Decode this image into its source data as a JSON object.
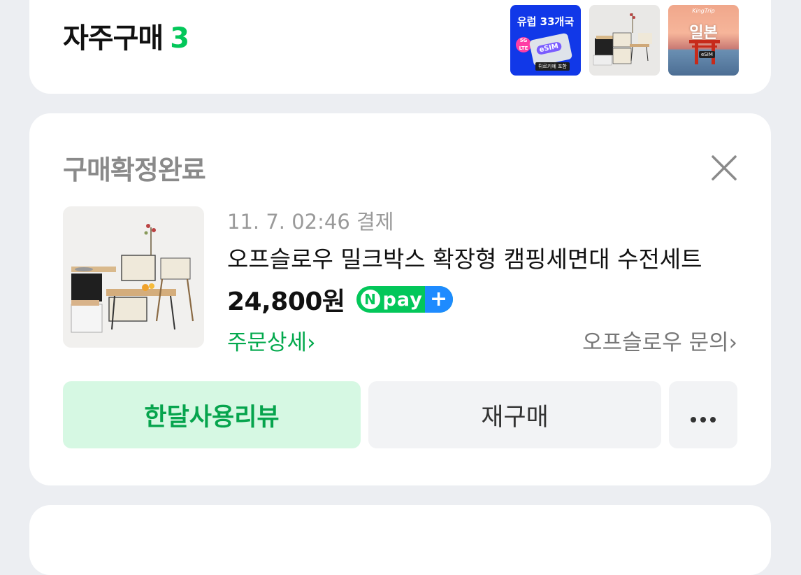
{
  "frequent": {
    "title": "자주구매",
    "count": "3",
    "thumbs": [
      {
        "name": "esim-europe",
        "headline": "유럽 33개국",
        "badge": "5G LTE",
        "sim": "eSIM",
        "sub": "튀르키예 포함"
      },
      {
        "name": "camping-washstand"
      },
      {
        "name": "esim-japan",
        "script": "KingTrip",
        "headline": "일본",
        "tag": "eSIM"
      }
    ]
  },
  "order": {
    "status": "구매확정완료",
    "date": "11. 7. 02:46 결제",
    "product_name": "오프슬로우 밀크박스 확장형 캠핑세면대 수전세트",
    "price": "24,800원",
    "npay": {
      "n": "N",
      "pay": "pay",
      "plus": "+"
    },
    "detail_link": "주문상세›",
    "seller_link": "오프슬로우 문의›",
    "buttons": {
      "review": "한달사용리뷰",
      "rebuy": "재구매"
    }
  },
  "colors": {
    "accent_green": "#03c75a",
    "review_bg": "#d6f8e3",
    "page_bg": "#eceef2",
    "npay_plus_blue": "#1e8bff"
  }
}
